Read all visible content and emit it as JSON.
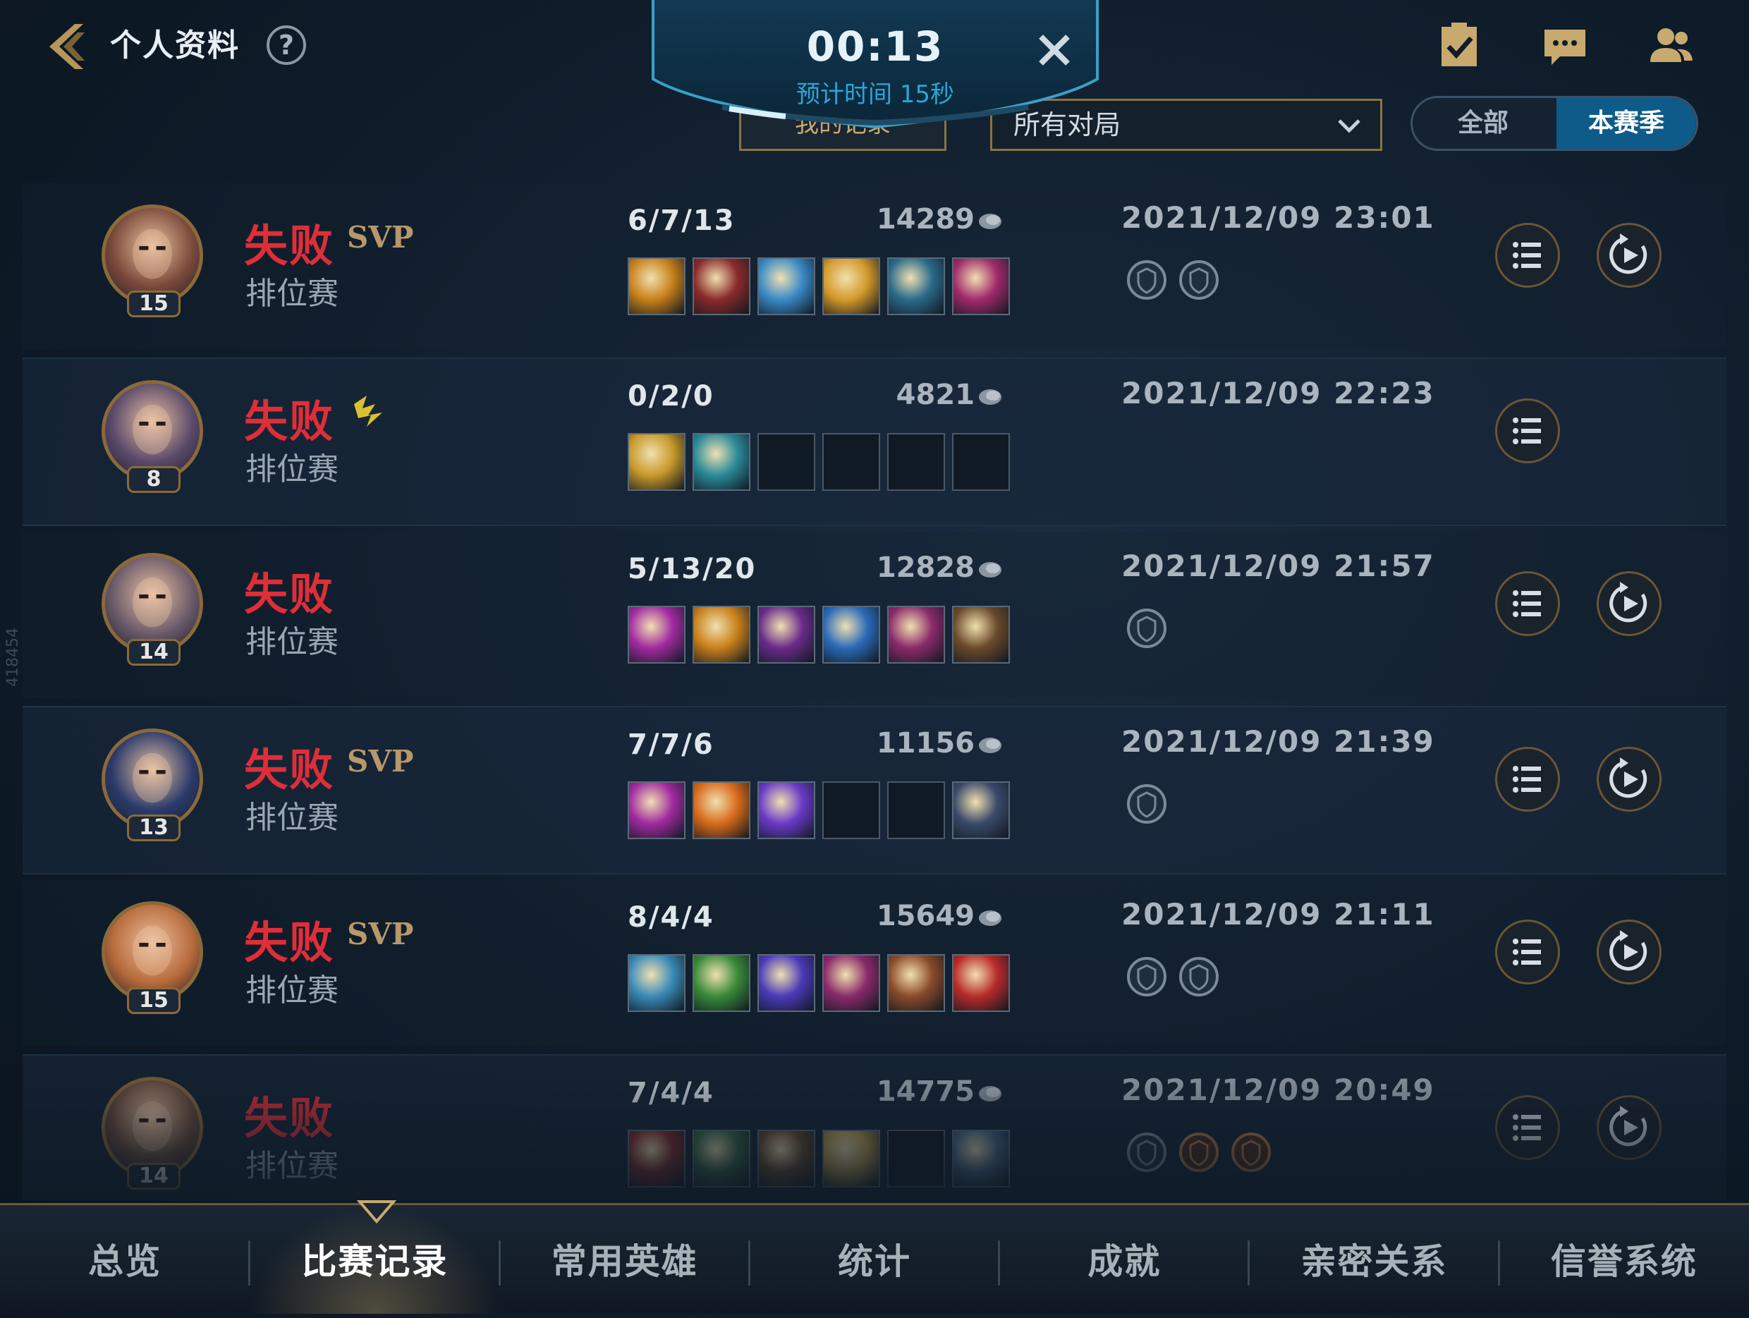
{
  "header": {
    "title": "个人资料",
    "help_symbol": "?",
    "icons": [
      "back-arrow-icon",
      "task-clipboard-icon",
      "chat-icon",
      "friends-icon"
    ]
  },
  "timer": {
    "time": "00:13",
    "estimate": "预计时间 15秒",
    "progress": 0.25
  },
  "filters": {
    "left_button_label": "我的记录",
    "dropdown_value": "所有对局",
    "segment": [
      "全部",
      "本赛季"
    ],
    "segment_selected": "本赛季"
  },
  "side_label": "418454",
  "matches": [
    {
      "result": "失败",
      "badge": "SVP",
      "mode": "排位赛",
      "level": "15",
      "kda": "6/7/13",
      "gold": "14289",
      "date": "2021/12/09 23:01",
      "items": [
        "#c8801a",
        "#8a2a2a",
        "#3a8ac8",
        "#d49a2a",
        "#2a6a8a",
        "#a02a6a"
      ],
      "honors": [
        "honor-icon",
        "honor-icon"
      ],
      "replay": true,
      "avatar_color": "#7a4a3a"
    },
    {
      "result": "失败",
      "badge": "",
      "mode": "排位赛",
      "level": "8",
      "kda": "0/2/0",
      "gold": "4821",
      "date": "2021/12/09 22:23",
      "items": [
        "#c89a2a",
        "#2a8a9a",
        "",
        "",
        "",
        ""
      ],
      "honors": [],
      "replay": false,
      "avatar_color": "#5a4a6a"
    },
    {
      "result": "失败",
      "badge": "",
      "mode": "排位赛",
      "level": "14",
      "kda": "5/13/20",
      "gold": "12828",
      "date": "2021/12/09 21:57",
      "items": [
        "#a02aa0",
        "#c8801a",
        "#6a2a8a",
        "#2a6ab8",
        "#8a2a6a",
        "#6a4a2a"
      ],
      "honors": [
        "honor-icon"
      ],
      "replay": true,
      "avatar_color": "#6a5a6a"
    },
    {
      "result": "失败",
      "badge": "SVP",
      "mode": "排位赛",
      "level": "13",
      "kda": "7/7/6",
      "gold": "11156",
      "date": "2021/12/09 21:39",
      "items": [
        "#a02aa0",
        "#d86a1a",
        "#6a3ac8",
        "",
        "",
        "#3a4a6a"
      ],
      "honors": [
        "honor-icon"
      ],
      "replay": true,
      "avatar_color": "#2a3a6a"
    },
    {
      "result": "失败",
      "badge": "SVP",
      "mode": "排位赛",
      "level": "15",
      "kda": "8/4/4",
      "gold": "15649",
      "date": "2021/12/09 21:11",
      "items": [
        "#3a8ab8",
        "#3a8a3a",
        "#4a3ab8",
        "#8a2a6a",
        "#8a4a2a",
        "#b82a2a"
      ],
      "honors": [
        "honor-icon",
        "honor-icon"
      ],
      "replay": true,
      "avatar_color": "#b86a3a"
    },
    {
      "result": "失败",
      "badge": "",
      "mode": "排位赛",
      "level": "14",
      "kda": "7/4/4",
      "gold": "14775",
      "date": "2021/12/09 20:49",
      "items": [
        "#8a2a2a",
        "#3a6a4a",
        "#6a4a2a",
        "#b89a4a",
        "",
        "#4a6a8a"
      ],
      "honors": [
        "honor-icon",
        "honor-bronze-icon",
        "honor-bronze-icon"
      ],
      "replay": true,
      "avatar_color": "#6a4a3a"
    }
  ],
  "tabs": [
    {
      "label": "总览"
    },
    {
      "label": "比赛记录"
    },
    {
      "label": "常用英雄"
    },
    {
      "label": "统计"
    },
    {
      "label": "成就"
    },
    {
      "label": "亲密关系"
    },
    {
      "label": "信誉系统"
    }
  ],
  "active_tab": "比赛记录",
  "colors": {
    "defeat": "#e02e38",
    "gold_accent": "#c8aa6e",
    "selected_blue": "#0e5b8a",
    "timer_cyan": "#2aa6d8"
  }
}
